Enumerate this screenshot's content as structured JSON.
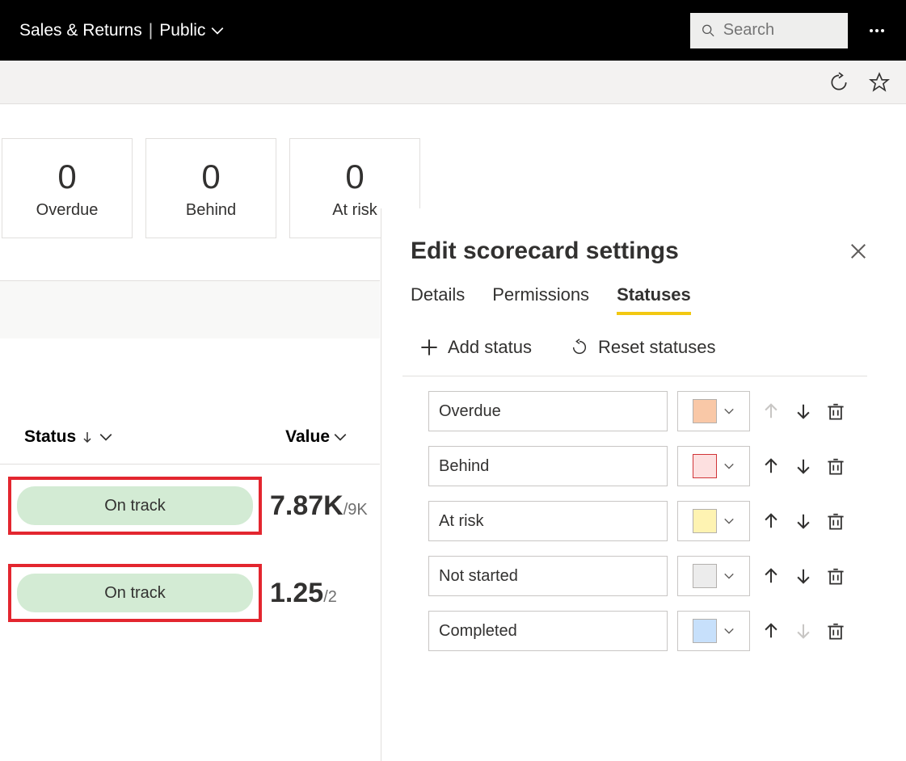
{
  "header": {
    "title": "Sales & Returns",
    "visibility": "Public",
    "search_placeholder": "Search"
  },
  "cards": [
    {
      "value": "0",
      "label": "Overdue"
    },
    {
      "value": "0",
      "label": "Behind"
    },
    {
      "value": "0",
      "label": "At risk"
    }
  ],
  "table": {
    "col_status": "Status",
    "col_value": "Value",
    "rows": [
      {
        "status": "On track",
        "value": "7.87K",
        "target": "/9K"
      },
      {
        "status": "On track",
        "value": "1.25",
        "target": "/2"
      }
    ]
  },
  "panel": {
    "title": "Edit scorecard settings",
    "tabs": {
      "details": "Details",
      "permissions": "Permissions",
      "statuses": "Statuses"
    },
    "add_label": "Add status",
    "reset_label": "Reset statuses",
    "statuses": [
      {
        "name": "Overdue",
        "color": "#f9c8a7",
        "up_disabled": true,
        "down_disabled": false
      },
      {
        "name": "Behind",
        "color": "#fde0e0",
        "up_disabled": false,
        "down_disabled": false,
        "border": "#d13438"
      },
      {
        "name": "At risk",
        "color": "#fef3b2",
        "up_disabled": false,
        "down_disabled": false
      },
      {
        "name": "Not started",
        "color": "#ececec",
        "up_disabled": false,
        "down_disabled": false
      },
      {
        "name": "Completed",
        "color": "#c7e0fb",
        "up_disabled": false,
        "down_disabled": true
      }
    ]
  }
}
